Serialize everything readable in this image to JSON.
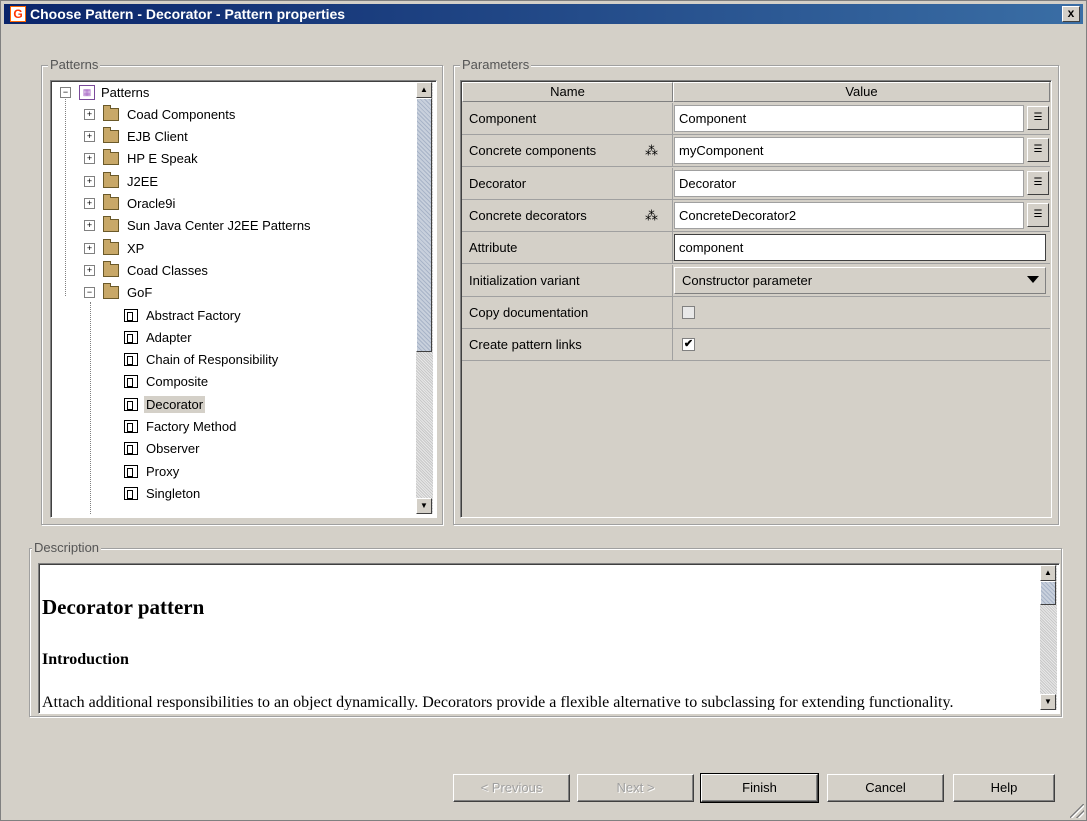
{
  "window": {
    "title": "Choose Pattern - Decorator - Pattern properties",
    "close_label": "x"
  },
  "patterns_panel": {
    "legend": "Patterns",
    "tree": [
      {
        "label": "Patterns",
        "level": 0,
        "type": "root",
        "expanded": true
      },
      {
        "label": "Coad Components",
        "level": 1,
        "type": "folder",
        "expanded": false
      },
      {
        "label": "EJB Client",
        "level": 1,
        "type": "folder",
        "expanded": false
      },
      {
        "label": "HP E Speak",
        "level": 1,
        "type": "folder",
        "expanded": false
      },
      {
        "label": "J2EE",
        "level": 1,
        "type": "folder",
        "expanded": false
      },
      {
        "label": "Oracle9i",
        "level": 1,
        "type": "folder",
        "expanded": false
      },
      {
        "label": "Sun Java Center J2EE Patterns",
        "level": 1,
        "type": "folder",
        "expanded": false
      },
      {
        "label": "XP",
        "level": 1,
        "type": "folder",
        "expanded": false
      },
      {
        "label": "Coad Classes",
        "level": 1,
        "type": "folder",
        "expanded": false
      },
      {
        "label": "GoF",
        "level": 1,
        "type": "folder",
        "expanded": true
      },
      {
        "label": "Abstract Factory",
        "level": 2,
        "type": "pattern"
      },
      {
        "label": "Adapter",
        "level": 2,
        "type": "pattern"
      },
      {
        "label": "Chain of Responsibility",
        "level": 2,
        "type": "pattern"
      },
      {
        "label": "Composite",
        "level": 2,
        "type": "pattern"
      },
      {
        "label": "Decorator",
        "level": 2,
        "type": "pattern",
        "selected": true
      },
      {
        "label": "Factory Method",
        "level": 2,
        "type": "pattern"
      },
      {
        "label": "Observer",
        "level": 2,
        "type": "pattern"
      },
      {
        "label": "Proxy",
        "level": 2,
        "type": "pattern"
      },
      {
        "label": "Singleton",
        "level": 2,
        "type": "pattern"
      }
    ]
  },
  "parameters_panel": {
    "legend": "Parameters",
    "columns": {
      "name": "Name",
      "value": "Value"
    },
    "rows": [
      {
        "name": "Component",
        "value": "Component",
        "kind": "text-button"
      },
      {
        "name": "Concrete components",
        "value": "myComponent",
        "kind": "text-button",
        "multi": true
      },
      {
        "name": "Decorator",
        "value": "Decorator",
        "kind": "text-button"
      },
      {
        "name": "Concrete decorators",
        "value": "ConcreteDecorator2",
        "kind": "text-button",
        "multi": true
      },
      {
        "name": "Attribute",
        "value": "component",
        "kind": "text-edit"
      },
      {
        "name": "Initialization variant",
        "value": "Constructor parameter",
        "kind": "combo"
      },
      {
        "name": "Copy documentation",
        "checked": false,
        "kind": "checkbox"
      },
      {
        "name": "Create pattern links",
        "checked": true,
        "kind": "checkbox"
      }
    ]
  },
  "description_panel": {
    "legend": "Description",
    "heading": "Decorator pattern",
    "subheading": "Introduction",
    "body": "Attach additional responsibilities to an object dynamically. Decorators provide a flexible alternative to subclassing for extending functionality."
  },
  "buttons": {
    "previous": "< Previous",
    "next": "Next >",
    "finish": "Finish",
    "cancel": "Cancel",
    "help": "Help"
  }
}
